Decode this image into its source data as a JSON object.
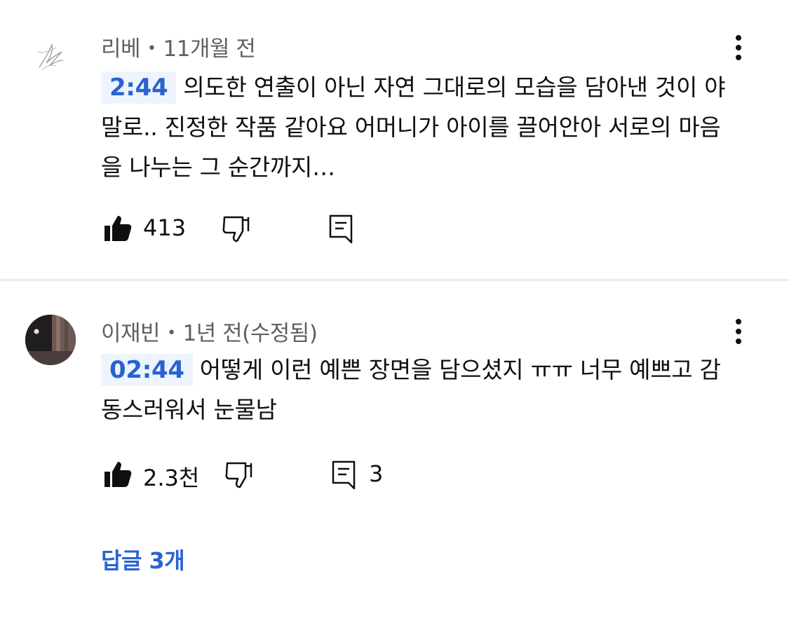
{
  "comments": [
    {
      "author": "리베",
      "dot": "•",
      "time": "11개월 전",
      "timestamp": "2:44",
      "text": "의도한 연출이 아닌 자연 그대로의 모습을 담아낸 것이 야말로.. 진정한 작품 같아요 어머니가 아이를 끌어안아 서로의 마음을 나누는 그 순간까지…",
      "likes": "413",
      "replies_count": ""
    },
    {
      "author": "이재빈",
      "dot": "•",
      "time": "1년 전(수정됨)",
      "timestamp": "02:44",
      "text": "어떻게 이런 예쁜 장면을 담으셨지 ㅠㅠ 너무 예쁘고 감동스러워서 눈물남",
      "likes": "2.3천",
      "replies_count": "3"
    }
  ],
  "replies_link": "답글 3개",
  "colors": {
    "accent": "#2a62d1",
    "timestamp_bg": "#eef4fd",
    "meta_text": "#606060"
  },
  "icons": [
    "like-icon",
    "dislike-icon",
    "reply-icon",
    "more-vert-icon"
  ]
}
